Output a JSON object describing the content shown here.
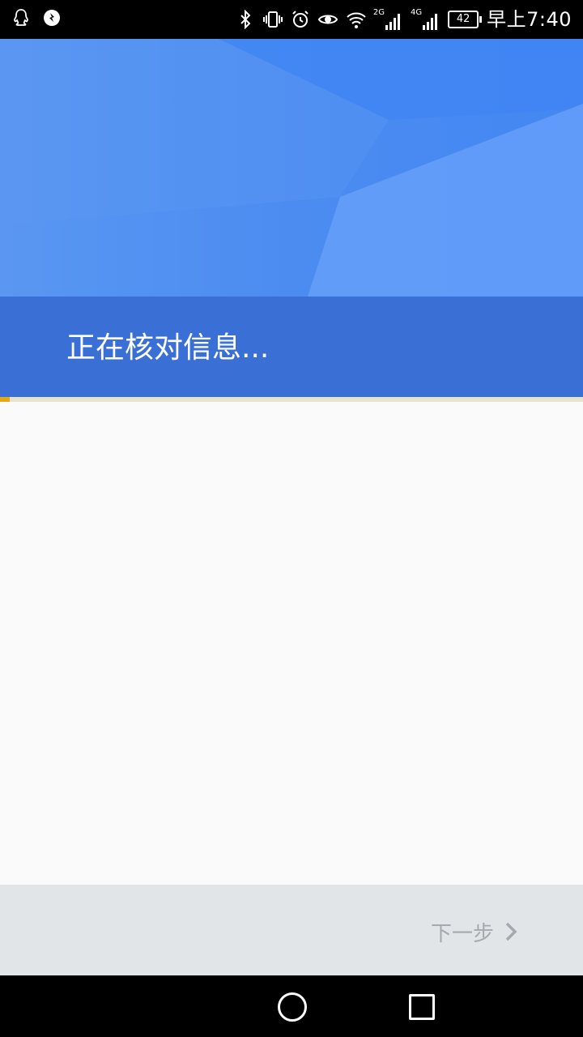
{
  "status_bar": {
    "left_icons": [
      "qq-icon",
      "location-app-icon"
    ],
    "right_icons": [
      "bluetooth-icon",
      "vibrate-icon",
      "alarm-icon",
      "eye-icon",
      "wifi-icon",
      "signal-2g-icon",
      "signal-4g-icon"
    ],
    "signal_2g_label": "2G",
    "signal_4g_label": "4G",
    "battery": "42",
    "time": "早上7:40"
  },
  "header": {
    "title": "正在核对信息...",
    "progress": 0.017,
    "colors": {
      "hero": "#4c8cf1",
      "title_bar": "#3a6fd6",
      "progress": "#e6a816"
    }
  },
  "footer": {
    "next_label": "下一步",
    "next_icon": "chevron-right-icon"
  },
  "nav_bar": {
    "buttons": [
      "home-button",
      "recents-button"
    ]
  }
}
